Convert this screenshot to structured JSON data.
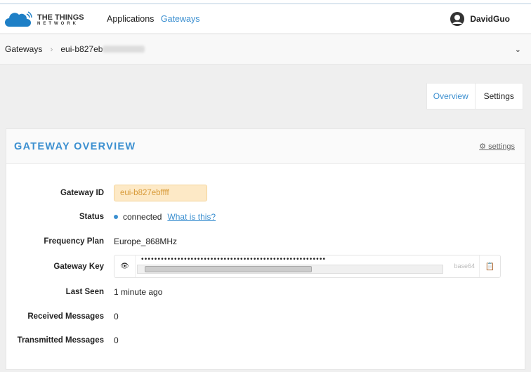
{
  "header": {
    "logo_line1": "THE THINGS",
    "logo_line2": "NETWORK",
    "nav": [
      "Applications",
      "Gateways"
    ],
    "user": "DavidGuo"
  },
  "breadcrumb": {
    "root": "Gateways",
    "current": "eui-b827eb"
  },
  "tabs": [
    "Overview",
    "Settings"
  ],
  "card": {
    "title": "GATEWAY OVERVIEW",
    "settings_link": "settings"
  },
  "fields": {
    "gateway_id_label": "Gateway ID",
    "gateway_id": "eui-b827ebffff",
    "status_label": "Status",
    "status": "connected",
    "status_help": "What is this?",
    "freq_label": "Frequency Plan",
    "freq": "Europe_868MHz",
    "key_label": "Gateway Key",
    "key_masked": "••••••••••••••••••••••••••••••••••••••••••••••••••••••••",
    "key_format": "base64",
    "last_seen_label": "Last Seen",
    "last_seen": "1 minute ago",
    "rx_label": "Received Messages",
    "rx": "0",
    "tx_label": "Transmitted Messages",
    "tx": "0"
  },
  "colors": {
    "accent": "#3b8fd0",
    "id_bg": "#fde9c6"
  }
}
